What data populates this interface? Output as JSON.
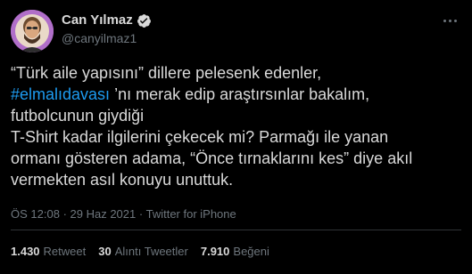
{
  "author": {
    "name": "Can Yılmaz",
    "handle": "@canyilmaz1",
    "verified": true,
    "avatar_bg": "#b06ec9"
  },
  "tweet": {
    "lines": [
      [
        "“Türk aile yapısını” dillere pelesenk edenler,"
      ],
      [
        "#elmalıdavası",
        " ’nı merak edip araştırsınlar bakalım,"
      ],
      [
        "futbolcunun giydiği"
      ],
      [
        "T-Shirt kadar ilgilerini çekecek mi? Parmağı ile yanan"
      ],
      [
        "ormanı gösteren adama, “Önce tırnaklarını kes” diye akıl"
      ],
      [
        "vermekten asıl konuyu unuttuk."
      ]
    ],
    "hashtag": "#elmalıdavası",
    "line2_rest": " ’nı merak edip araştırsınlar bakalım,",
    "line1": "“Türk aile yapısını” dillere pelesenk edenler,",
    "line3": "futbolcunun giydiği",
    "line4": "T-Shirt kadar ilgilerini çekecek mi? Parmağı ile yanan",
    "line5": "ormanı gösteren adama, “Önce tırnaklarını kes” diye akıl",
    "line6": "vermekten asıl konuyu unuttuk."
  },
  "meta": {
    "time": "ÖS 12:08",
    "date": "29 Haz 2021",
    "source": "Twitter for iPhone"
  },
  "stats": {
    "retweets_count": "1.430",
    "retweets_label": "Retweet",
    "quotes_count": "30",
    "quotes_label": "Alıntı Tweetler",
    "likes_count": "7.910",
    "likes_label": "Beğeni"
  },
  "colors": {
    "background": "#000000",
    "text": "#d9d9d9",
    "secondary": "#6e767d",
    "link": "#1d9bf0",
    "divider": "#2f3336",
    "verified": "#d9d9d9"
  },
  "icons": {
    "verified": "verified-badge-icon",
    "more": "more-options-icon"
  }
}
